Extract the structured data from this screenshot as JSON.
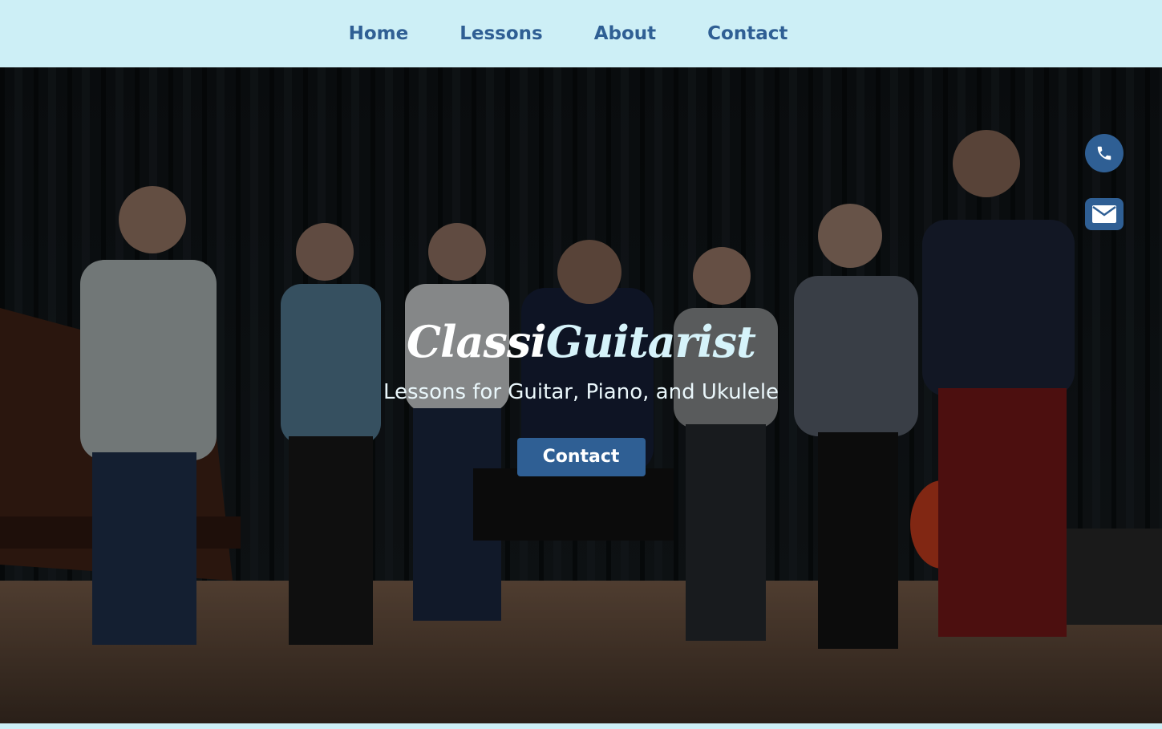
{
  "nav": {
    "items": [
      {
        "label": "Home"
      },
      {
        "label": "Lessons"
      },
      {
        "label": "About"
      },
      {
        "label": "Contact"
      }
    ]
  },
  "hero": {
    "brand_part1": "Classi",
    "brand_part2": "Guitarist",
    "tagline": "Lessons for Guitar, Piano, and Ukulele",
    "cta_label": "Contact",
    "image_description_icon": "hero-photo"
  },
  "floating_actions": {
    "phone_icon": "phone-icon",
    "mail_icon": "mail-icon"
  },
  "colors": {
    "nav_bg": "#cdeff6",
    "accent": "#2f5f94",
    "brand_highlight": "#d6f3fa"
  }
}
